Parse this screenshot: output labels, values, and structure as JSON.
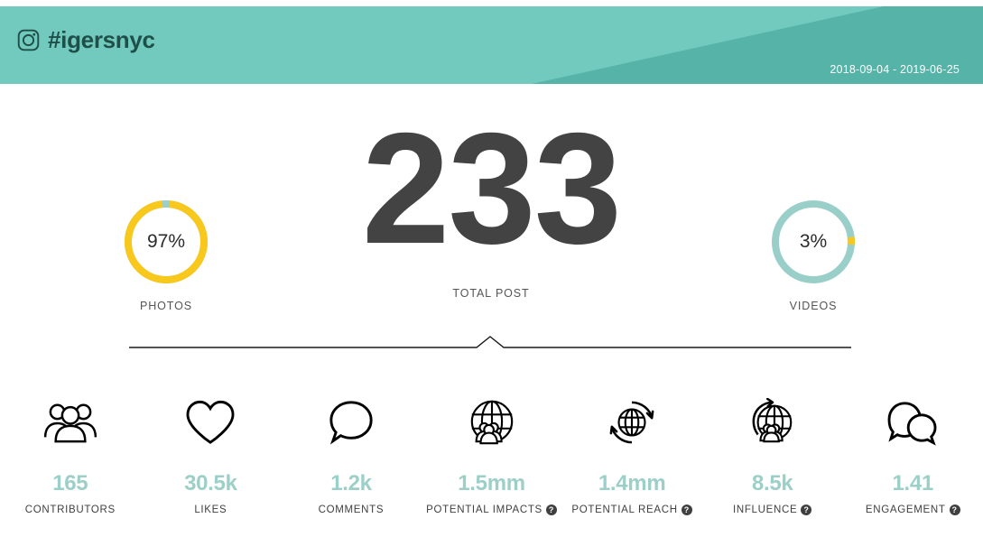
{
  "header": {
    "icon": "instagram-icon",
    "title": "#igersnyc",
    "date_range": "2018-09-04 - 2019-06-25",
    "bg_color": "#72c9be",
    "accent_color": "#55b3a7"
  },
  "summary": {
    "photos": {
      "label": "PHOTOS",
      "percent_text": "97%",
      "percent_value": 97,
      "ring_color": "#f8c81c",
      "remainder_color": "#9acfc9"
    },
    "videos": {
      "label": "VIDEOS",
      "percent_text": "3%",
      "percent_value": 3,
      "ring_color": "#9acfc9",
      "remainder_color": "#f8c81c"
    },
    "total": {
      "value": "233",
      "label": "TOTAL POST",
      "color": "#434343"
    }
  },
  "metrics": [
    {
      "icon": "people-group-icon",
      "value": "165",
      "label": "CONTRIBUTORS",
      "has_help": false
    },
    {
      "icon": "heart-icon",
      "value": "30.5k",
      "label": "LIKES",
      "has_help": false
    },
    {
      "icon": "speech-bubble-icon",
      "value": "1.2k",
      "label": "COMMENTS",
      "has_help": false
    },
    {
      "icon": "globe-people-icon",
      "value": "1.5mm",
      "label": "POTENTIAL IMPACTS",
      "has_help": true,
      "help_text": "?"
    },
    {
      "icon": "globe-refresh-icon",
      "value": "1.4mm",
      "label": "POTENTIAL REACH",
      "has_help": true,
      "help_text": "?"
    },
    {
      "icon": "globe-influence-icon",
      "value": "8.5k",
      "label": "INFLUENCE",
      "has_help": true,
      "help_text": "?"
    },
    {
      "icon": "double-bubble-icon",
      "value": "1.41",
      "label": "ENGAGEMENT",
      "has_help": true,
      "help_text": "?"
    }
  ],
  "colors": {
    "teal": "#9ccfc8",
    "yellow": "#f8c81c",
    "dark_gray": "#434343",
    "label_gray": "#3f3f3f"
  }
}
